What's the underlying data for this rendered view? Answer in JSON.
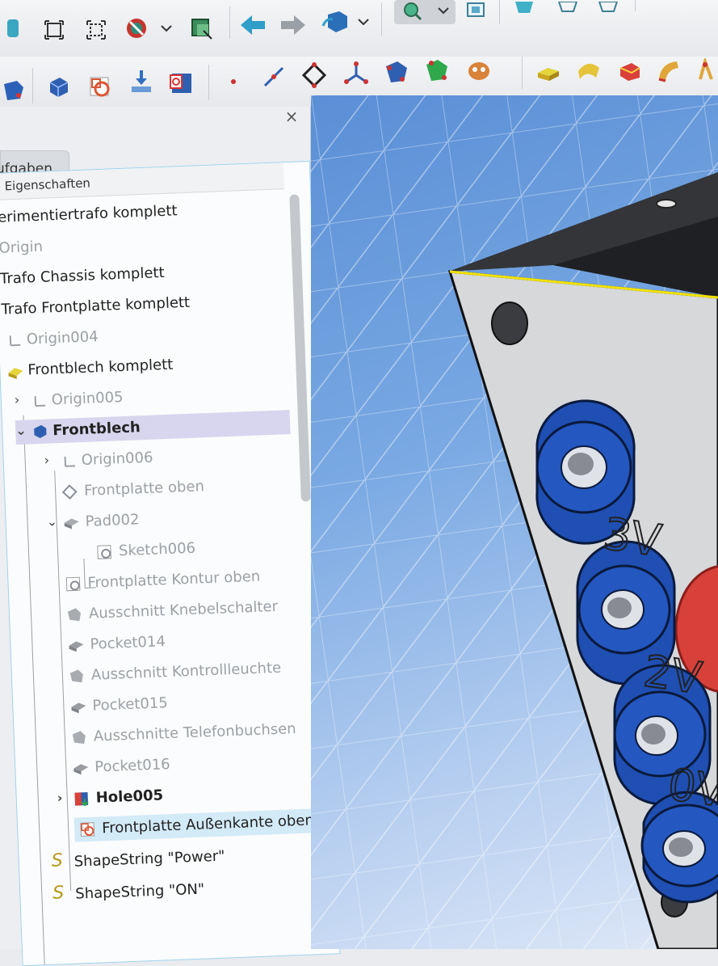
{
  "panel": {
    "tab_label": "ufgaben",
    "tree_header": "Eigenschaften",
    "close_glyph": "×"
  },
  "tree": [
    {
      "label": "erimentiertrafo komplett",
      "style": "normal"
    },
    {
      "label": "Origin",
      "style": "gray"
    },
    {
      "label": "Trafo Chassis komplett",
      "style": "normal"
    },
    {
      "label": "Trafo Frontplatte komplett",
      "style": "normal"
    },
    {
      "label": "Origin004",
      "style": "gray",
      "icon": "axes-icon"
    },
    {
      "label": "Frontblech komplett",
      "style": "normal",
      "icon": "part-icon"
    },
    {
      "label": "Origin005",
      "style": "gray",
      "icon": "axes-icon"
    },
    {
      "label": "Frontblech",
      "style": "bold",
      "icon": "body-icon"
    },
    {
      "label": "Origin006",
      "style": "gray",
      "icon": "axes-icon"
    },
    {
      "label": "Frontplatte oben",
      "style": "gray",
      "icon": "datum-plane-icon"
    },
    {
      "label": "Pad002",
      "style": "gray",
      "icon": "pad-icon"
    },
    {
      "label": "Sketch006",
      "style": "gray",
      "icon": "sketch-icon"
    },
    {
      "label": "Frontplatte Kontur oben",
      "style": "gray",
      "icon": "sketch-icon"
    },
    {
      "label": "Ausschnitt Knebelschalter",
      "style": "gray",
      "icon": "shape-icon"
    },
    {
      "label": "Pocket014",
      "style": "gray",
      "icon": "pocket-icon"
    },
    {
      "label": "Ausschnitt Kontrollleuchte",
      "style": "gray",
      "icon": "shape-icon"
    },
    {
      "label": "Pocket015",
      "style": "gray",
      "icon": "pocket-icon"
    },
    {
      "label": "Ausschnitte Telefonbuchsen",
      "style": "gray",
      "icon": "shape-icon"
    },
    {
      "label": "Pocket016",
      "style": "gray",
      "icon": "pocket-icon"
    },
    {
      "label": "Hole005",
      "style": "normal",
      "icon": "hole-icon"
    },
    {
      "label": "Frontplatte Außenkante oben",
      "style": "normal",
      "icon": "sketch-icon"
    },
    {
      "label": "ShapeString \"Power\"",
      "style": "normal",
      "icon": "shapestring-icon"
    },
    {
      "label": "ShapeString \"ON\"",
      "style": "normal",
      "icon": "shapestring-icon"
    }
  ],
  "viewport": {
    "labels": [
      "3V",
      "2V",
      "0V"
    ]
  },
  "colors": {
    "accent_blue": "#1f4fb3",
    "selection": "#d8d6ee",
    "selection_active": "#d3eaf7",
    "edge_highlight": "#f2e200",
    "knob_red": "#d8403a"
  }
}
